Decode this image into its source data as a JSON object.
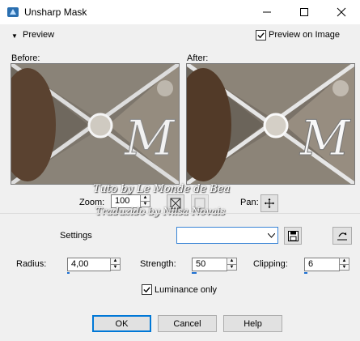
{
  "window": {
    "title": "Unsharp Mask",
    "controls": [
      "minimize",
      "maximize",
      "close"
    ]
  },
  "preview": {
    "toggle_label": "Preview",
    "preview_on_image_label": "Preview on Image",
    "preview_on_image_checked": true,
    "before_label": "Before:",
    "after_label": "After:"
  },
  "zoom": {
    "label": "Zoom:",
    "value": "100",
    "pan_label": "Pan:"
  },
  "watermark": {
    "line1": "Tuto by Le Monde de Bea",
    "line2": "Traduzido by Nilsa Novais"
  },
  "settings": {
    "label": "Settings",
    "selected": ""
  },
  "params": {
    "radius_label": "Radius:",
    "radius_value": "4,00",
    "strength_label": "Strength:",
    "strength_value": "50",
    "clipping_label": "Clipping:",
    "clipping_value": "6"
  },
  "luminance": {
    "label": "Luminance only",
    "checked": true
  },
  "buttons": {
    "ok": "OK",
    "cancel": "Cancel",
    "help": "Help"
  },
  "icons": {
    "app": "paint-app-icon",
    "pan": "move-icon",
    "zoom_fit": "zoom-fit-icon",
    "zoom_actual": "zoom-actual-icon",
    "save": "save-icon",
    "reset": "reset-icon"
  }
}
